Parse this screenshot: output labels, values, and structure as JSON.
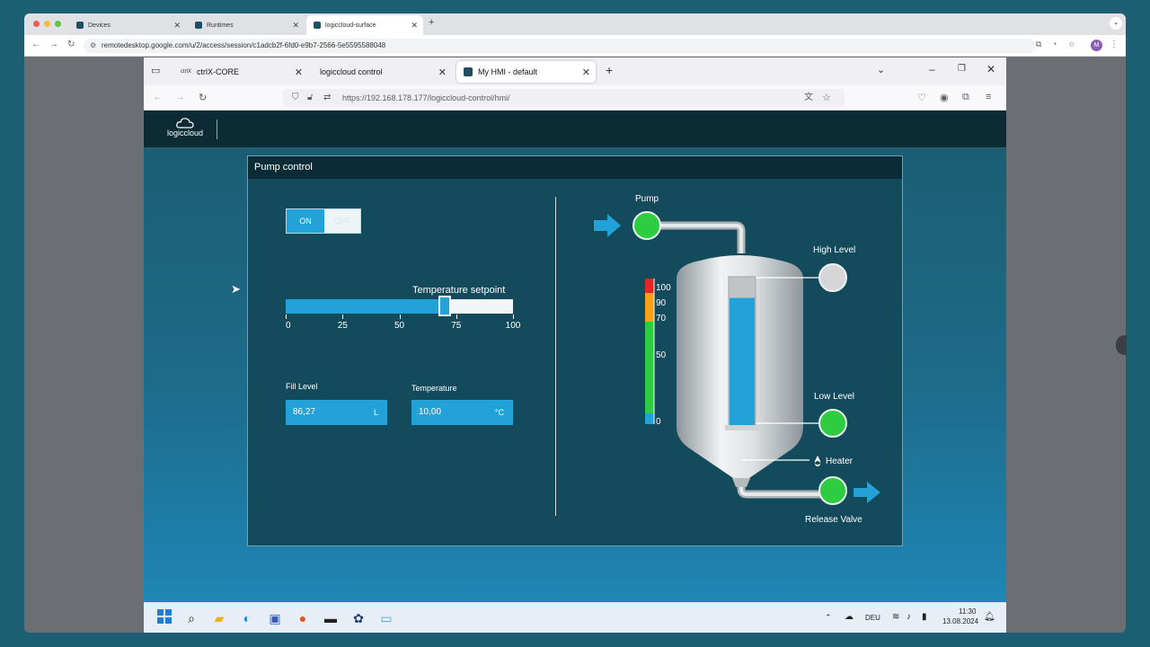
{
  "outer_browser": {
    "tabs": [
      {
        "label": "Devices"
      },
      {
        "label": "Runtimes"
      },
      {
        "label": "logiccloud-surface"
      }
    ],
    "url": "remotedesktop.google.com/u/2/access/session/c1adcb2f-6fd0-e9b7-2566-5e5595588048",
    "profile_initial": "M"
  },
  "inner_browser": {
    "tabs": [
      {
        "label": "ctrlX-CORE"
      },
      {
        "label": "logiccloud control"
      },
      {
        "label": "My HMI - default"
      }
    ],
    "url": "https://192.168.178.177/logiccloud-control/hmi/"
  },
  "app": {
    "logo_text": "logiccloud",
    "panel_title": "Pump control",
    "toggle": {
      "on_label": "ON",
      "off_label": "OFF",
      "state": "on"
    },
    "setpoint": {
      "label": "Temperature setpoint",
      "value": 70,
      "min": 0,
      "max": 100,
      "ticks": [
        "0",
        "25",
        "50",
        "75",
        "100"
      ]
    },
    "fill_level": {
      "label": "Fill Level",
      "value": "86,27",
      "unit": "L"
    },
    "temperature": {
      "label": "Temperature",
      "value": "10,00",
      "unit": "°C"
    },
    "diagram": {
      "pump_label": "Pump",
      "high_level_label": "High Level",
      "low_level_label": "Low Level",
      "heater_label": "Heater",
      "release_valve_label": "Release Valve",
      "gauge_ticks": [
        "100",
        "90",
        "70",
        "50",
        "0"
      ],
      "tank_level_percent": 86,
      "indicator_on": "#2ecc40",
      "indicator_off": "#d4d6d8",
      "pump_state": "on",
      "high_level_state": "off",
      "low_level_state": "on",
      "release_valve_state": "on"
    }
  },
  "taskbar": {
    "lang": "DEU",
    "time": "11:30",
    "date": "13.08.2024"
  },
  "colors": {
    "accent": "#23a2d8",
    "panel": "#134a5c",
    "header": "#0c2b35"
  }
}
